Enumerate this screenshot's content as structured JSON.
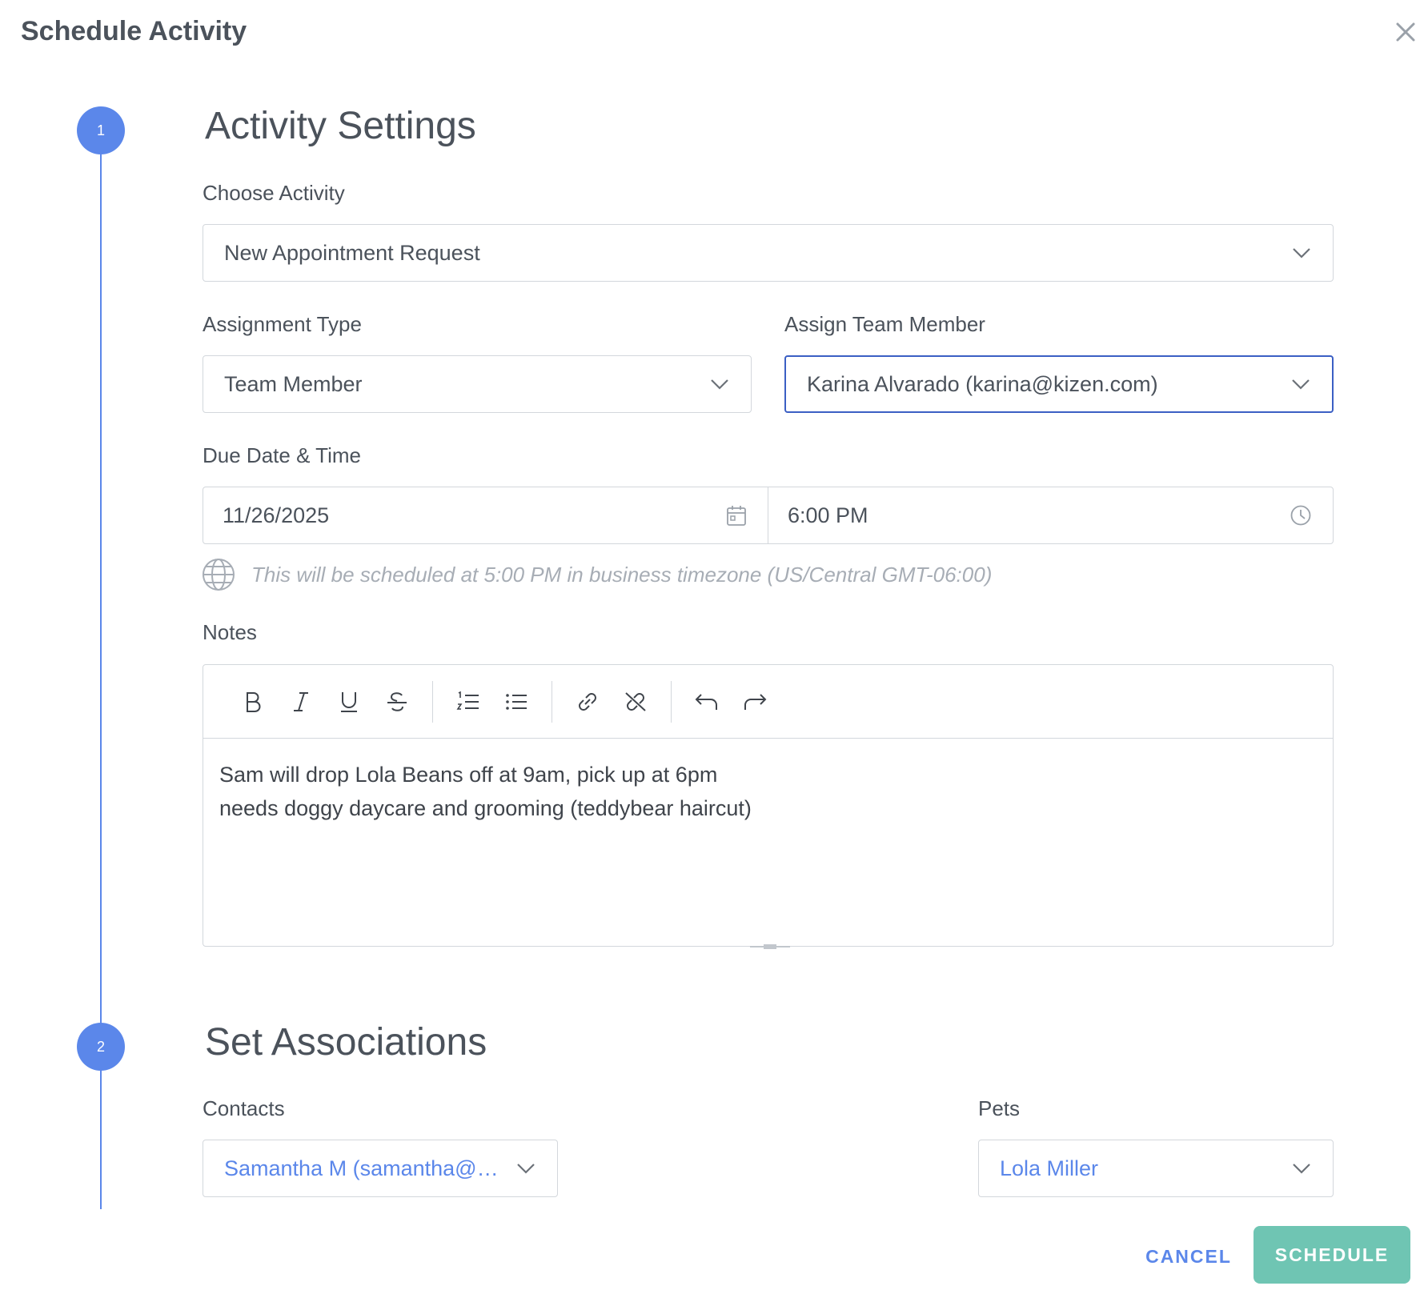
{
  "dialog": {
    "title": "Schedule Activity"
  },
  "steps": [
    {
      "number": "1",
      "title": "Activity Settings"
    },
    {
      "number": "2",
      "title": "Set Associations"
    }
  ],
  "activity": {
    "choose_label": "Choose Activity",
    "choose_value": "New Appointment Request",
    "assignment_type_label": "Assignment Type",
    "assignment_type_value": "Team Member",
    "team_member_label": "Assign Team Member",
    "team_member_value": "Karina Alvarado (karina@kizen.com)",
    "due_label": "Due Date & Time",
    "due_date": "11/26/2025",
    "due_time": "6:00 PM",
    "timezone_note": "This will be scheduled at 5:00 PM in business timezone (US/Central GMT-06:00)",
    "notes_label": "Notes",
    "notes_lines": [
      "Sam will drop Lola Beans off at 9am, pick up at 6pm",
      "needs doggy daycare and grooming (teddybear haircut)"
    ]
  },
  "toolbar": {
    "icons": [
      "bold-icon",
      "italic-icon",
      "underline-icon",
      "strikethrough-icon",
      "ordered-list-icon",
      "bullet-list-icon",
      "link-icon",
      "unlink-icon",
      "undo-icon",
      "redo-icon"
    ]
  },
  "associations": {
    "contacts_label": "Contacts",
    "contacts_value": "Samantha M (samantha@fa...",
    "pets_label": "Pets",
    "pets_value": "Lola Miller"
  },
  "actions": {
    "cancel": "CANCEL",
    "schedule": "SCHEDULE"
  },
  "colors": {
    "accent": "#5b87ea",
    "focus_border": "#3b5fc4",
    "schedule_button": "#6fc5b3",
    "hint_text": "#a7adb5"
  }
}
